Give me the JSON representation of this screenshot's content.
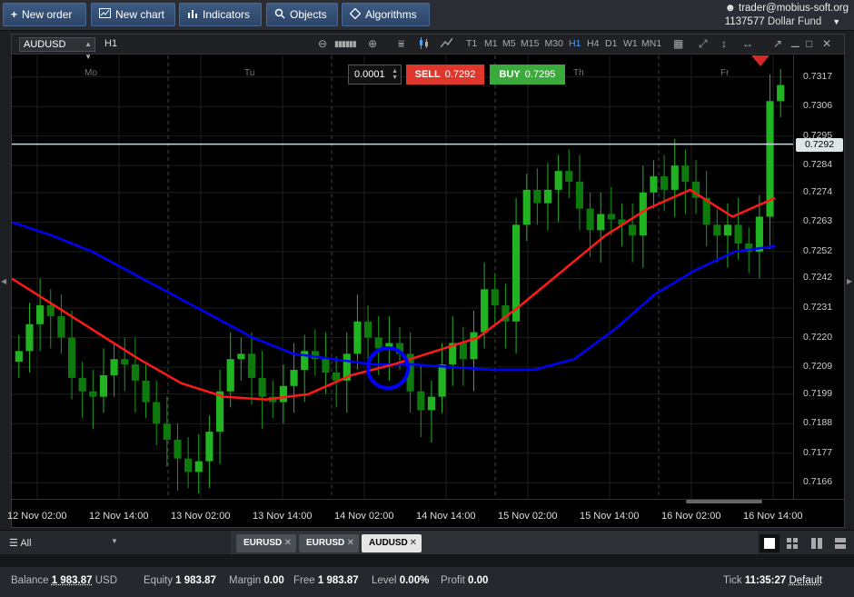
{
  "toolbar": {
    "new_order": "New order",
    "new_chart": "New chart",
    "indicators": "Indicators",
    "objects": "Objects",
    "algorithms": "Algorithms"
  },
  "account": {
    "user": "trader@mobius-soft.org",
    "number": "1137577",
    "fund": "Dollar Fund"
  },
  "chart_header": {
    "symbol": "AUDUSD",
    "timeframe": "H1",
    "timeframes": [
      "T1",
      "M1",
      "M5",
      "M15",
      "M30",
      "H1",
      "H4",
      "D1",
      "W1",
      "MN1"
    ],
    "active_timeframe": "H1"
  },
  "trade": {
    "quantity": "0.0001",
    "sell_label": "SELL",
    "sell_price": "0.7292",
    "buy_label": "BUY",
    "buy_price": "0.7295"
  },
  "day_labels": [
    "Mo",
    "Tu",
    "Th",
    "Fr"
  ],
  "price_axis": [
    "0.7317",
    "0.7306",
    "0.7295",
    "0.7284",
    "0.7274",
    "0.7263",
    "0.7252",
    "0.7242",
    "0.7231",
    "0.7220",
    "0.7209",
    "0.7199",
    "0.7188",
    "0.7177",
    "0.7166"
  ],
  "current_price": "0.7292",
  "time_axis": [
    "12 Nov 02:00",
    "12 Nov 14:00",
    "13 Nov 02:00",
    "13 Nov 14:00",
    "14 Nov 02:00",
    "14 Nov 14:00",
    "15 Nov 02:00",
    "15 Nov 14:00",
    "16 Nov 02:00",
    "16 Nov 14:00"
  ],
  "chart_data": {
    "type": "candlestick",
    "symbol": "AUDUSD",
    "interval": "H1",
    "ylim": [
      0.716,
      0.7325
    ],
    "horizontal_line": 0.7292,
    "series": [
      {
        "kind": "candles",
        "close_path": [
          0.7215,
          0.7225,
          0.7232,
          0.7228,
          0.722,
          0.7205,
          0.72,
          0.7198,
          0.7206,
          0.7212,
          0.721,
          0.7204,
          0.7196,
          0.7188,
          0.7182,
          0.7175,
          0.717,
          0.7174,
          0.7185,
          0.72,
          0.7212,
          0.7214,
          0.7205,
          0.7198,
          0.7196,
          0.7202,
          0.7208,
          0.7215,
          0.7212,
          0.7207,
          0.7204,
          0.7214,
          0.7226,
          0.722,
          0.7216,
          0.7218,
          0.7214,
          0.72,
          0.7193,
          0.7198,
          0.721,
          0.7218,
          0.7212,
          0.7222,
          0.7238,
          0.7232,
          0.7226,
          0.7262,
          0.7275,
          0.727,
          0.7275,
          0.7282,
          0.7278,
          0.7268,
          0.726,
          0.7266,
          0.7264,
          0.7262,
          0.7258,
          0.7274,
          0.728,
          0.7275,
          0.7284,
          0.7278,
          0.7272,
          0.7262,
          0.7258,
          0.7262,
          0.7255,
          0.7252,
          0.7265,
          0.7308,
          0.7314
        ]
      },
      {
        "name": "",
        "kind": "moving-average",
        "color": "#0000ff",
        "values": [
          0.7263,
          0.7258,
          0.7252,
          0.7244,
          0.7236,
          0.7228,
          0.722,
          0.7214,
          0.7212,
          0.721,
          0.721,
          0.7209,
          0.7208,
          0.7208,
          0.7212,
          0.7223,
          0.7236,
          0.7245,
          0.7252,
          0.7254
        ]
      },
      {
        "name": "",
        "kind": "moving-average",
        "color": "#ff1a1a",
        "values": [
          0.7242,
          0.7232,
          0.7222,
          0.7212,
          0.7203,
          0.7198,
          0.7197,
          0.7199,
          0.7206,
          0.721,
          0.7215,
          0.722,
          0.7232,
          0.7245,
          0.7258,
          0.7268,
          0.7275,
          0.7265,
          0.7272
        ]
      }
    ],
    "marker": {
      "type": "circle",
      "color": "#0000ff"
    },
    "grid": true
  },
  "tabs_bar": {
    "filter": "All",
    "tabs": [
      {
        "label": "EURUSD"
      },
      {
        "label": "EURUSD"
      },
      {
        "label": "AUDUSD"
      }
    ]
  },
  "status": {
    "balance_label": "Balance",
    "balance": "1 983.87",
    "currency": "USD",
    "equity_label": "Equity",
    "equity": "1 983.87",
    "margin_label": "Margin",
    "margin": "0.00",
    "free_label": "Free",
    "free": "1 983.87",
    "level_label": "Level",
    "level": "0.00%",
    "profit_label": "Profit",
    "profit": "0.00",
    "tick_label": "Tick",
    "time": "11:35:27",
    "server": "Default"
  },
  "colors": {
    "bull": "#22b322",
    "bear": "#0d6b0d",
    "accent": "#3d5a82",
    "sell": "#e0372c",
    "buy": "#3aaa3a"
  }
}
